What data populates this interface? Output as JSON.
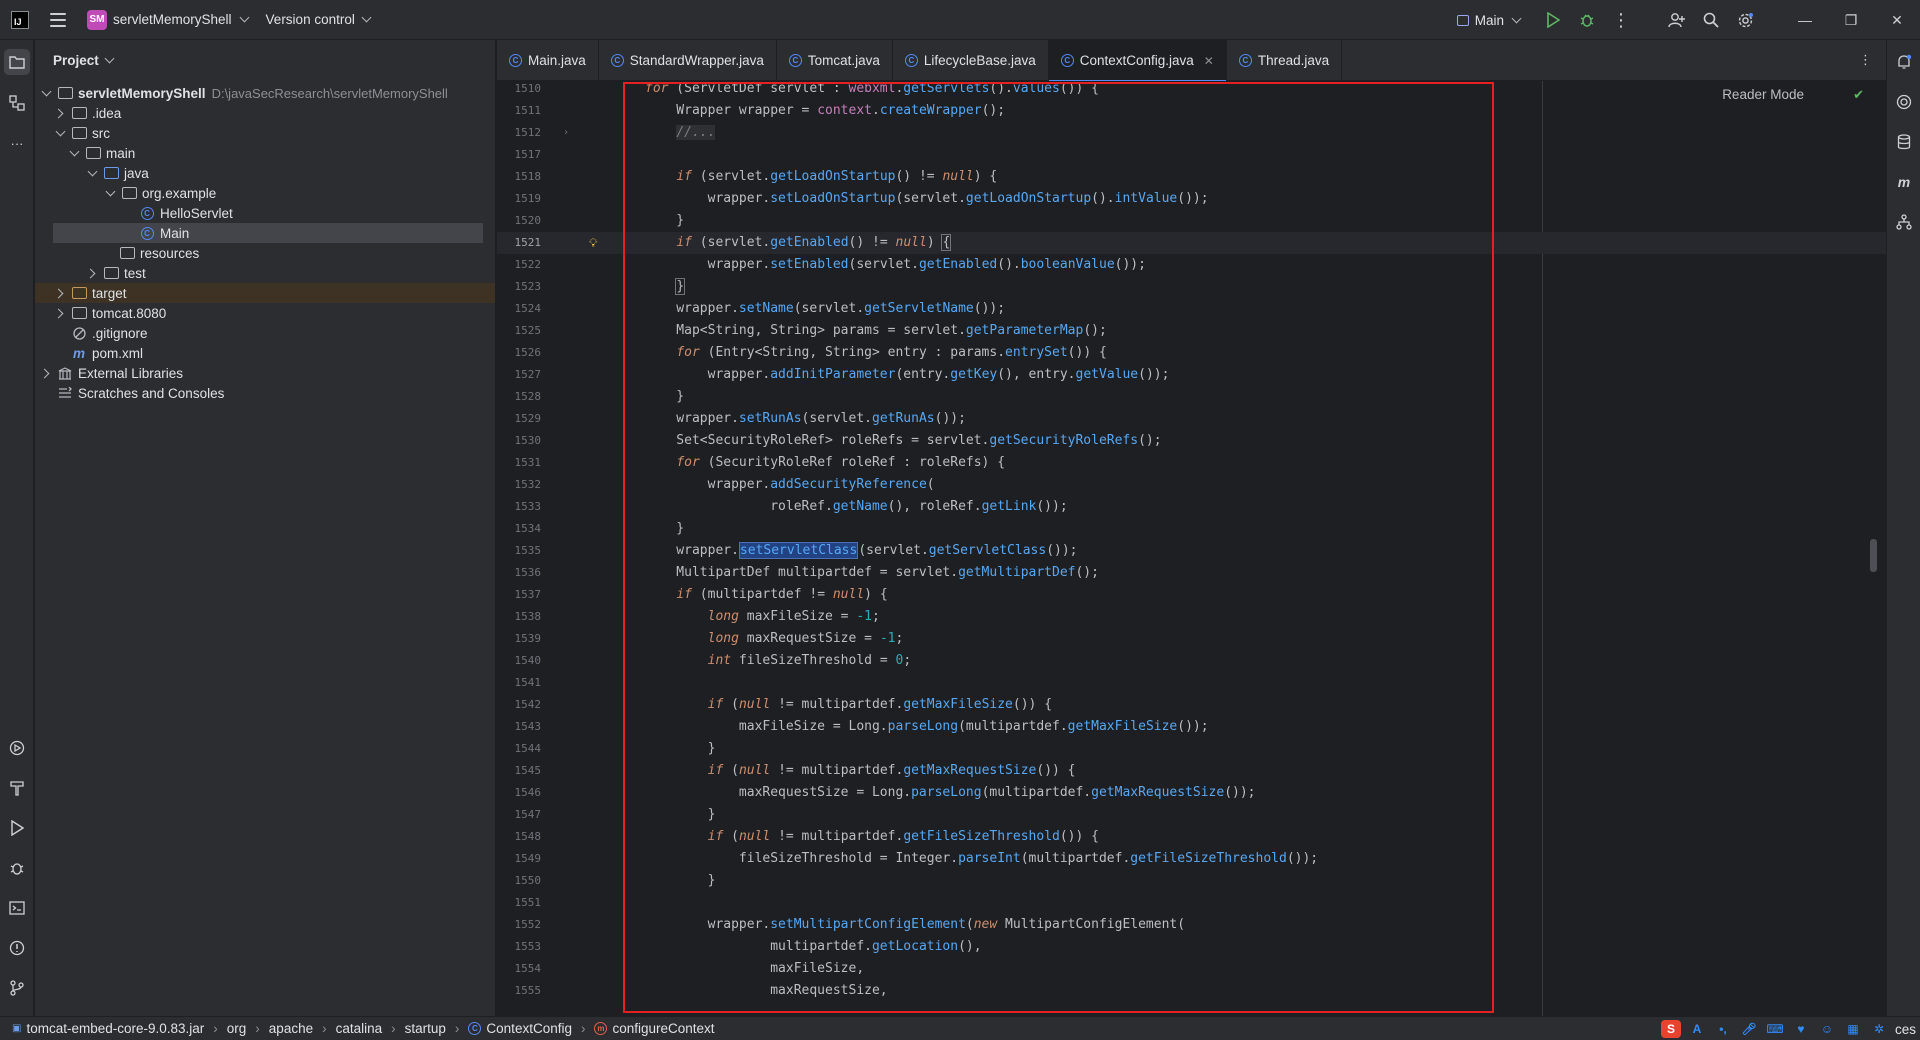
{
  "titlebar": {
    "logo": "IJ",
    "project_badge": "SM",
    "project_name": "servletMemoryShell",
    "vcs_label": "Version control",
    "run_config": "Main"
  },
  "project_panel": {
    "title": "Project",
    "tree": [
      {
        "label": "servletMemoryShell",
        "path": "D:\\javaSecResearch\\servletMemoryShell",
        "type": "module"
      },
      {
        "label": ".idea",
        "type": "folder"
      },
      {
        "label": "src",
        "type": "folder"
      },
      {
        "label": "main",
        "type": "folder"
      },
      {
        "label": "java",
        "type": "src-folder"
      },
      {
        "label": "org.example",
        "type": "package"
      },
      {
        "label": "HelloServlet",
        "type": "class"
      },
      {
        "label": "Main",
        "type": "class"
      },
      {
        "label": "resources",
        "type": "folder"
      },
      {
        "label": "test",
        "type": "folder"
      },
      {
        "label": "target",
        "type": "excluded-folder"
      },
      {
        "label": "tomcat.8080",
        "type": "folder"
      },
      {
        "label": ".gitignore",
        "type": "file"
      },
      {
        "label": "pom.xml",
        "type": "maven"
      },
      {
        "label": "External Libraries",
        "type": "libraries"
      },
      {
        "label": "Scratches and Consoles",
        "type": "scratches"
      }
    ]
  },
  "tabs": [
    {
      "label": "Main.java"
    },
    {
      "label": "StandardWrapper.java"
    },
    {
      "label": "Tomcat.java"
    },
    {
      "label": "LifecycleBase.java"
    },
    {
      "label": "ContextConfig.java",
      "active": true
    },
    {
      "label": "Thread.java"
    }
  ],
  "editor": {
    "reader_mode": "Reader Mode",
    "line_numbers": [
      "1510",
      "1511",
      "1512",
      "1517",
      "1518",
      "1519",
      "1520",
      "1521",
      "1522",
      "1523",
      "1524",
      "1525",
      "1526",
      "1527",
      "1528",
      "1529",
      "1530",
      "1531",
      "1532",
      "1533",
      "1534",
      "1535",
      "1536",
      "1537",
      "1538",
      "1539",
      "1540",
      "1541",
      "1542",
      "1543",
      "1544",
      "1545",
      "1546",
      "1547",
      "1548",
      "1549",
      "1550",
      "1551",
      "1552",
      "1553",
      "1554",
      "1555"
    ],
    "current_line": "1521",
    "selected_word": "setServletClass"
  },
  "statusbar": {
    "crumbs": [
      "tomcat-embed-core-9.0.83.jar",
      "org",
      "apache",
      "catalina",
      "startup",
      "ContextConfig",
      "configureContext"
    ],
    "tail": "ces"
  }
}
